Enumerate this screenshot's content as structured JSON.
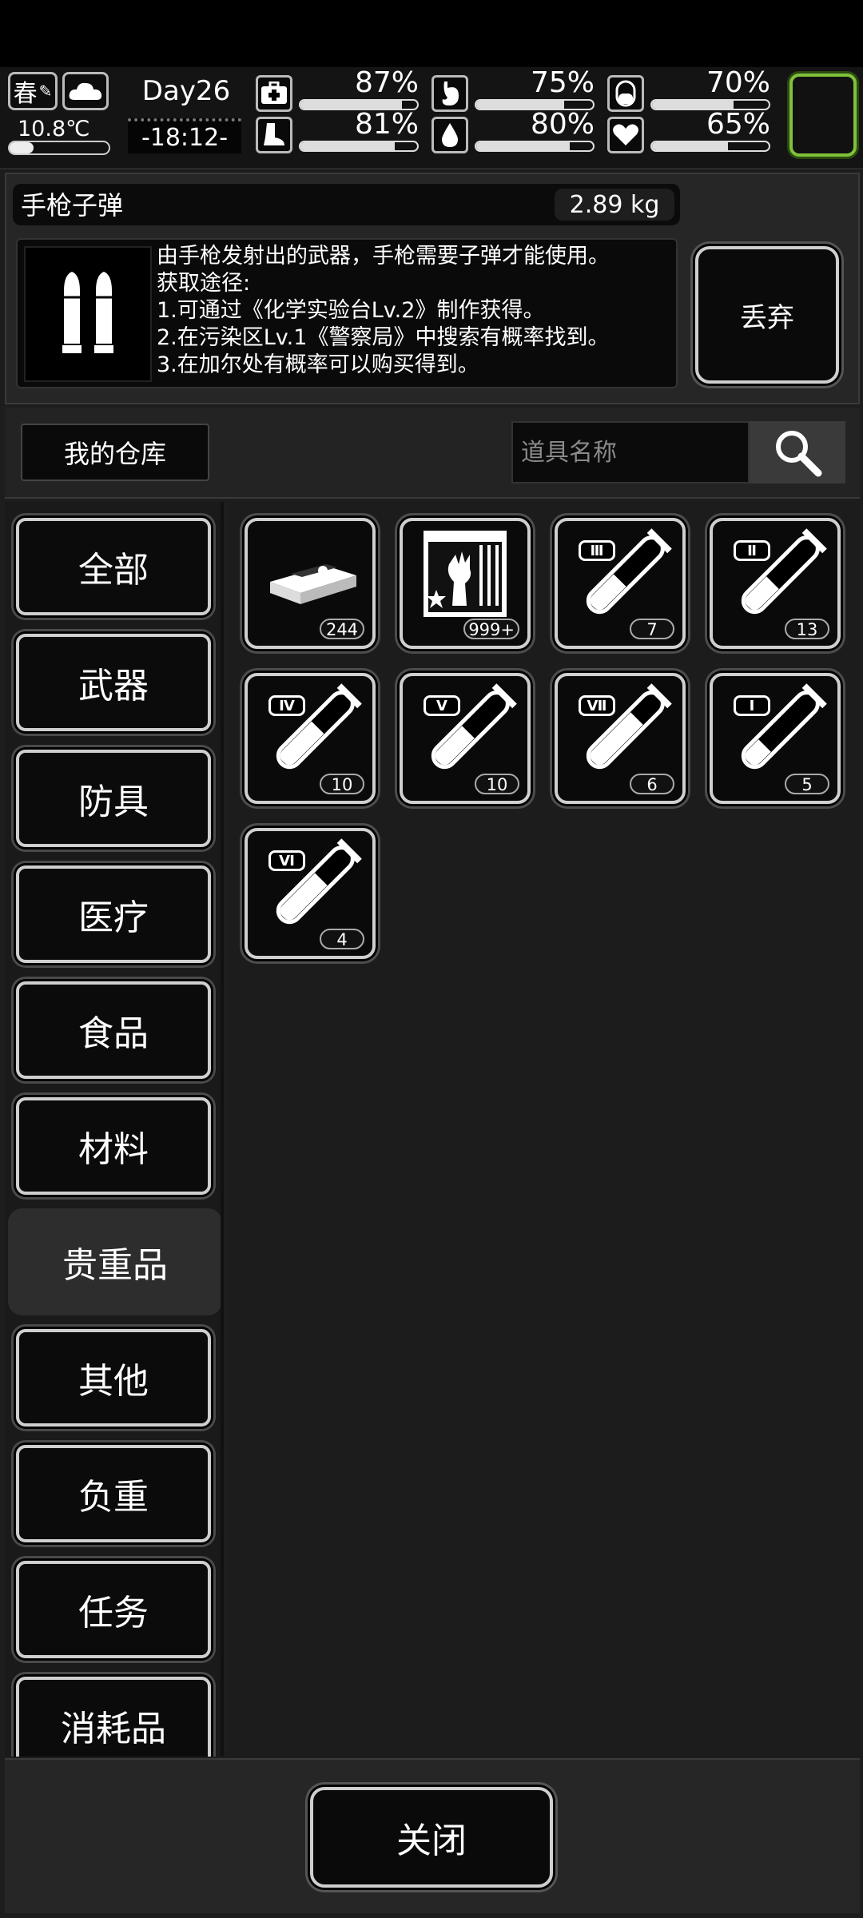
{
  "hud": {
    "season": "春",
    "day": "Day26",
    "temperature": "10.8℃",
    "time": "-18:12-",
    "stats": [
      {
        "icon": "medkit-icon",
        "percent": "87%",
        "level": 0.87
      },
      {
        "icon": "stomach-icon",
        "percent": "75%",
        "level": 0.75
      },
      {
        "icon": "pill-icon",
        "percent": "70%",
        "level": 0.7
      },
      {
        "icon": "boot-icon",
        "percent": "81%",
        "level": 0.81
      },
      {
        "icon": "water-drop-icon",
        "percent": "80%",
        "level": 0.8
      },
      {
        "icon": "heart-icon",
        "percent": "65%",
        "level": 0.65
      }
    ],
    "accent_green": "#7fc23a"
  },
  "item": {
    "name": "手枪子弹",
    "weight": "2.89 kg",
    "description": "由手枪发射出的武器，手枪需要子弹才能使用。\n获取途径:\n1.可通过《化学实验台Lv.2》制作获得。\n2.在污染区Lv.1《警察局》中搜索有概率找到。\n3.在加尔处有概率可以购买得到。",
    "icon": "bullets-icon",
    "discard_label": "丢弃"
  },
  "warehouse": {
    "title": "我的仓库",
    "search_placeholder": "道具名称"
  },
  "categories": [
    "全部",
    "武器",
    "防具",
    "医疗",
    "食品",
    "材料",
    "贵重品",
    "其他",
    "负重",
    "任务",
    "消耗品"
  ],
  "active_category": "贵重品",
  "slots": [
    {
      "icon": "cash-stack-icon",
      "count": "244"
    },
    {
      "icon": "zombie-card-icon",
      "count": "999+"
    },
    {
      "icon": "test-tube-icon",
      "tier": "Ⅲ",
      "count": "7"
    },
    {
      "icon": "test-tube-icon",
      "tier": "Ⅱ",
      "count": "13"
    },
    {
      "icon": "test-tube-icon",
      "tier": "Ⅳ",
      "count": "10"
    },
    {
      "icon": "test-tube-icon",
      "tier": "Ⅴ",
      "count": "10"
    },
    {
      "icon": "test-tube-icon",
      "tier": "Ⅶ",
      "count": "6"
    },
    {
      "icon": "test-tube-icon",
      "tier": "Ⅰ",
      "count": "5"
    },
    {
      "icon": "test-tube-icon",
      "tier": "Ⅵ",
      "count": "4"
    }
  ],
  "close_label": "关闭"
}
